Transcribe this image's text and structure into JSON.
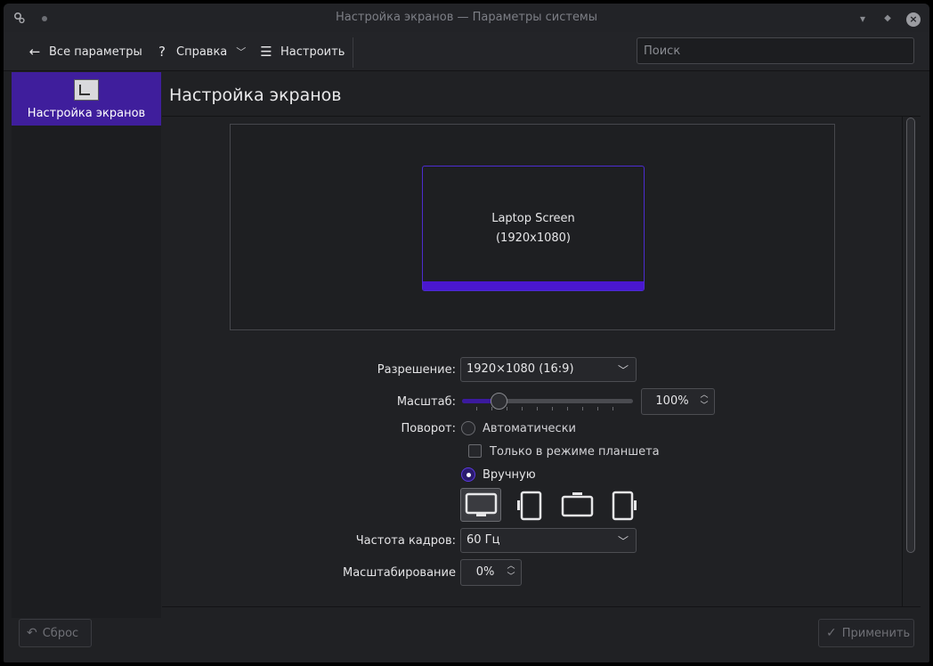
{
  "window": {
    "title": "Настройка экранов — Параметры системы"
  },
  "toolbar": {
    "back_label": "Все параметры",
    "help_label": "Справка",
    "configure_label": "Настроить",
    "search_placeholder": "Поиск"
  },
  "sidebar": {
    "items": [
      {
        "label": "Настройка экранов",
        "selected": true
      }
    ]
  },
  "page": {
    "title": "Настройка экранов"
  },
  "display": {
    "name": "Laptop Screen",
    "resolution_text": "(1920x1080)"
  },
  "form": {
    "resolution": {
      "label": "Разрешение:",
      "value": "1920×1080 (16:9)"
    },
    "scale": {
      "label": "Масштаб:",
      "value": "100%",
      "slider_fraction": 0.2
    },
    "rotation": {
      "label": "Поворот:",
      "auto_label": "Автоматически",
      "tablet_only_label": "Только в режиме планшета",
      "manual_label": "Вручную",
      "selected": "manual",
      "orientations": [
        "landscape",
        "portrait-left",
        "landscape-flipped",
        "portrait-right"
      ],
      "active_orientation": "landscape"
    },
    "refresh": {
      "label": "Частота кадров:",
      "value": "60 Гц"
    },
    "overscan": {
      "label": "Масштабирование",
      "value": "0%"
    }
  },
  "footer": {
    "reset_label": "Сброс",
    "apply_label": "Применить"
  },
  "colors": {
    "accent": "#4a17cf",
    "selection": "#3f1e9c",
    "background": "#202124"
  },
  "icons": {
    "back": "arrow-left-icon",
    "help": "question-mark-icon",
    "configure": "hamburger-menu-icon",
    "reset": "undo-icon",
    "apply": "checkmark-icon"
  }
}
